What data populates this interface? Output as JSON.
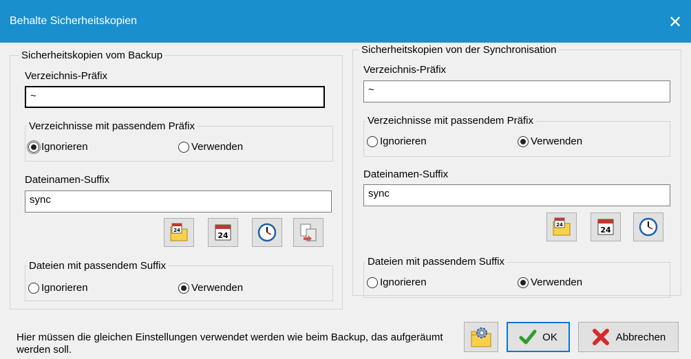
{
  "window": {
    "title": "Behalte Sicherheitskopien",
    "close_glyph": "✕"
  },
  "left": {
    "group_title": "Sicherheitskopien vom Backup",
    "dir_prefix_label": "Verzeichnis-Präfix",
    "dir_prefix_value": "~",
    "dirs_group_title": "Verzeichnisse mit passendem Präfix",
    "dirs_ignore": "Ignorieren",
    "dirs_use": "Verwenden",
    "dirs_selected": "ignore",
    "suffix_label": "Dateinamen-Suffix",
    "suffix_value": "sync",
    "files_group_title": "Dateien mit passendem Suffix",
    "files_ignore": "Ignorieren",
    "files_use": "Verwenden",
    "files_selected": "use",
    "icons": [
      "calendar-folder-icon",
      "calendar-icon",
      "clock-icon",
      "copy-file-icon"
    ]
  },
  "right": {
    "group_title": "Sicherheitskopien von der Synchronisation",
    "dir_prefix_label": "Verzeichnis-Präfix",
    "dir_prefix_value": "~",
    "dirs_group_title": "Verzeichnisse mit passendem Präfix",
    "dirs_ignore": "Ignorieren",
    "dirs_use": "Verwenden",
    "dirs_selected": "use",
    "suffix_label": "Dateinamen-Suffix",
    "suffix_value": "sync",
    "files_group_title": "Dateien mit passendem Suffix",
    "files_ignore": "Ignorieren",
    "files_use": "Verwenden",
    "files_selected": "use",
    "icons": [
      "calendar-folder-icon",
      "calendar-icon",
      "clock-icon"
    ]
  },
  "calendar_day": "24",
  "footer": {
    "hint": "Hier müssen die gleichen Einstellungen verwendet werden wie beim Backup, das aufgeräumt werden soll.",
    "ok_label": "OK",
    "cancel_label": "Abbrechen"
  },
  "colors": {
    "titlebar": "#1a8fcd",
    "accent": "#0078d7",
    "ok_check": "#2e9d2e",
    "cancel_x": "#d42b2b"
  }
}
